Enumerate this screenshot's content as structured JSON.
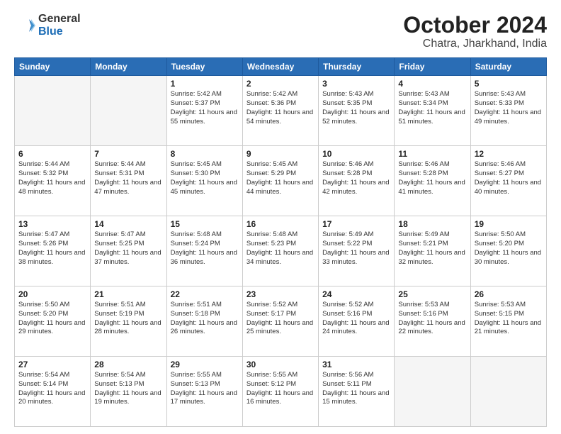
{
  "header": {
    "logo": {
      "general": "General",
      "blue": "Blue"
    },
    "title": "October 2024",
    "subtitle": "Chatra, Jharkhand, India"
  },
  "calendar": {
    "days_of_week": [
      "Sunday",
      "Monday",
      "Tuesday",
      "Wednesday",
      "Thursday",
      "Friday",
      "Saturday"
    ],
    "weeks": [
      [
        {
          "day": "",
          "info": ""
        },
        {
          "day": "",
          "info": ""
        },
        {
          "day": "1",
          "info": "Sunrise: 5:42 AM\nSunset: 5:37 PM\nDaylight: 11 hours and 55 minutes."
        },
        {
          "day": "2",
          "info": "Sunrise: 5:42 AM\nSunset: 5:36 PM\nDaylight: 11 hours and 54 minutes."
        },
        {
          "day": "3",
          "info": "Sunrise: 5:43 AM\nSunset: 5:35 PM\nDaylight: 11 hours and 52 minutes."
        },
        {
          "day": "4",
          "info": "Sunrise: 5:43 AM\nSunset: 5:34 PM\nDaylight: 11 hours and 51 minutes."
        },
        {
          "day": "5",
          "info": "Sunrise: 5:43 AM\nSunset: 5:33 PM\nDaylight: 11 hours and 49 minutes."
        }
      ],
      [
        {
          "day": "6",
          "info": "Sunrise: 5:44 AM\nSunset: 5:32 PM\nDaylight: 11 hours and 48 minutes."
        },
        {
          "day": "7",
          "info": "Sunrise: 5:44 AM\nSunset: 5:31 PM\nDaylight: 11 hours and 47 minutes."
        },
        {
          "day": "8",
          "info": "Sunrise: 5:45 AM\nSunset: 5:30 PM\nDaylight: 11 hours and 45 minutes."
        },
        {
          "day": "9",
          "info": "Sunrise: 5:45 AM\nSunset: 5:29 PM\nDaylight: 11 hours and 44 minutes."
        },
        {
          "day": "10",
          "info": "Sunrise: 5:46 AM\nSunset: 5:28 PM\nDaylight: 11 hours and 42 minutes."
        },
        {
          "day": "11",
          "info": "Sunrise: 5:46 AM\nSunset: 5:28 PM\nDaylight: 11 hours and 41 minutes."
        },
        {
          "day": "12",
          "info": "Sunrise: 5:46 AM\nSunset: 5:27 PM\nDaylight: 11 hours and 40 minutes."
        }
      ],
      [
        {
          "day": "13",
          "info": "Sunrise: 5:47 AM\nSunset: 5:26 PM\nDaylight: 11 hours and 38 minutes."
        },
        {
          "day": "14",
          "info": "Sunrise: 5:47 AM\nSunset: 5:25 PM\nDaylight: 11 hours and 37 minutes."
        },
        {
          "day": "15",
          "info": "Sunrise: 5:48 AM\nSunset: 5:24 PM\nDaylight: 11 hours and 36 minutes."
        },
        {
          "day": "16",
          "info": "Sunrise: 5:48 AM\nSunset: 5:23 PM\nDaylight: 11 hours and 34 minutes."
        },
        {
          "day": "17",
          "info": "Sunrise: 5:49 AM\nSunset: 5:22 PM\nDaylight: 11 hours and 33 minutes."
        },
        {
          "day": "18",
          "info": "Sunrise: 5:49 AM\nSunset: 5:21 PM\nDaylight: 11 hours and 32 minutes."
        },
        {
          "day": "19",
          "info": "Sunrise: 5:50 AM\nSunset: 5:20 PM\nDaylight: 11 hours and 30 minutes."
        }
      ],
      [
        {
          "day": "20",
          "info": "Sunrise: 5:50 AM\nSunset: 5:20 PM\nDaylight: 11 hours and 29 minutes."
        },
        {
          "day": "21",
          "info": "Sunrise: 5:51 AM\nSunset: 5:19 PM\nDaylight: 11 hours and 28 minutes."
        },
        {
          "day": "22",
          "info": "Sunrise: 5:51 AM\nSunset: 5:18 PM\nDaylight: 11 hours and 26 minutes."
        },
        {
          "day": "23",
          "info": "Sunrise: 5:52 AM\nSunset: 5:17 PM\nDaylight: 11 hours and 25 minutes."
        },
        {
          "day": "24",
          "info": "Sunrise: 5:52 AM\nSunset: 5:16 PM\nDaylight: 11 hours and 24 minutes."
        },
        {
          "day": "25",
          "info": "Sunrise: 5:53 AM\nSunset: 5:16 PM\nDaylight: 11 hours and 22 minutes."
        },
        {
          "day": "26",
          "info": "Sunrise: 5:53 AM\nSunset: 5:15 PM\nDaylight: 11 hours and 21 minutes."
        }
      ],
      [
        {
          "day": "27",
          "info": "Sunrise: 5:54 AM\nSunset: 5:14 PM\nDaylight: 11 hours and 20 minutes."
        },
        {
          "day": "28",
          "info": "Sunrise: 5:54 AM\nSunset: 5:13 PM\nDaylight: 11 hours and 19 minutes."
        },
        {
          "day": "29",
          "info": "Sunrise: 5:55 AM\nSunset: 5:13 PM\nDaylight: 11 hours and 17 minutes."
        },
        {
          "day": "30",
          "info": "Sunrise: 5:55 AM\nSunset: 5:12 PM\nDaylight: 11 hours and 16 minutes."
        },
        {
          "day": "31",
          "info": "Sunrise: 5:56 AM\nSunset: 5:11 PM\nDaylight: 11 hours and 15 minutes."
        },
        {
          "day": "",
          "info": ""
        },
        {
          "day": "",
          "info": ""
        }
      ]
    ]
  }
}
